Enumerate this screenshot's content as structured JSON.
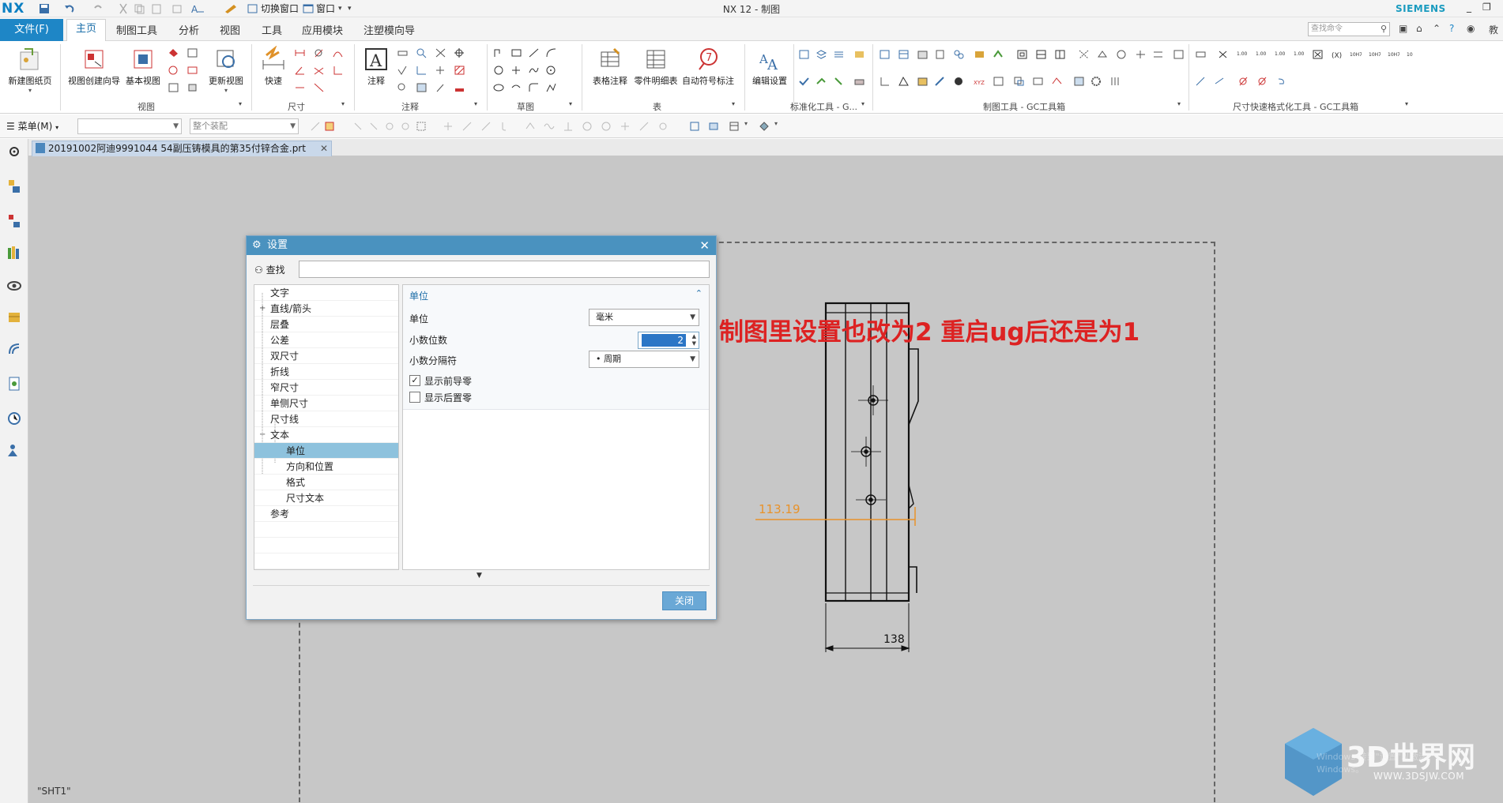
{
  "titlebar": {
    "logo": "NX",
    "switch_window": "切换窗口",
    "window_menu": "窗口",
    "title": "NX 12 - 制图",
    "brand": "SIEMENS"
  },
  "menu": {
    "file": "文件(F)",
    "tabs": [
      "主页",
      "制图工具",
      "分析",
      "视图",
      "工具",
      "应用模块",
      "注塑模向导"
    ],
    "search_placeholder": "查找命令",
    "corner_text": "教"
  },
  "ribbon": {
    "buttons": {
      "new_sheet": "新建图纸页",
      "view_wizard": "视图创建向导",
      "base_view": "基本视图",
      "update_view": "更新视图",
      "quick": "快速",
      "note": "注释",
      "table_note": "表格注释",
      "parts_list": "零件明细表",
      "auto_balloon": "自动符号标注",
      "edit_settings": "编辑设置"
    },
    "groups": [
      "视图",
      "尺寸",
      "注释",
      "草图",
      "表",
      "标准化工具 - G...",
      "制图工具 - GC工具箱",
      "尺寸快速格式化工具 - GC工具箱"
    ]
  },
  "toolbar2": {
    "menu": "菜单(M)",
    "filter_placeholder": "",
    "assembly_placeholder": "整个装配"
  },
  "document": {
    "tab": "20191002阿迪9991044  54副压铸模具的第35付锌合金.prt",
    "sheet": "\"SHT1\""
  },
  "drawing": {
    "dim_horizontal": "113.19",
    "dim_bottom": "138"
  },
  "annotation": {
    "text": "制图里设置也改为2  重启ug后还是为1"
  },
  "dialog": {
    "title": "设置",
    "find_label": "查找",
    "tree": [
      {
        "label": "文字",
        "level": 0,
        "expander": ""
      },
      {
        "label": "直线/箭头",
        "level": 0,
        "expander": "+"
      },
      {
        "label": "层叠",
        "level": 0,
        "expander": ""
      },
      {
        "label": "公差",
        "level": 0,
        "expander": ""
      },
      {
        "label": "双尺寸",
        "level": 0,
        "expander": ""
      },
      {
        "label": "折线",
        "level": 0,
        "expander": ""
      },
      {
        "label": "窄尺寸",
        "level": 0,
        "expander": ""
      },
      {
        "label": "单侧尺寸",
        "level": 0,
        "expander": ""
      },
      {
        "label": "尺寸线",
        "level": 0,
        "expander": ""
      },
      {
        "label": "文本",
        "level": 0,
        "expander": "−"
      },
      {
        "label": "单位",
        "level": 1,
        "expander": "",
        "selected": true
      },
      {
        "label": "方向和位置",
        "level": 1,
        "expander": ""
      },
      {
        "label": "格式",
        "level": 1,
        "expander": ""
      },
      {
        "label": "尺寸文本",
        "level": 1,
        "expander": ""
      },
      {
        "label": "参考",
        "level": 0,
        "expander": ""
      }
    ],
    "panel": {
      "title": "单位",
      "unit_label": "单位",
      "unit_value": "毫米",
      "decimals_label": "小数位数",
      "decimals_value": "2",
      "separator_label": "小数分隔符",
      "separator_value": "• 周期",
      "show_leading_zeros": "显示前导零",
      "show_leading_checked": "✓",
      "show_trailing_zeros": "显示后置零",
      "show_trailing_checked": ""
    },
    "close": "关闭"
  },
  "watermark": {
    "site": "3D世界网",
    "url": "WWW.3DSJW.COM",
    "ghost": "Windows 转到\"设置\"以激活 Windows。"
  },
  "colors": {
    "accent": "#1e86c6",
    "dialog_title": "#4a92bf",
    "annotation": "#dd2222",
    "dimension": "#e8922a"
  }
}
